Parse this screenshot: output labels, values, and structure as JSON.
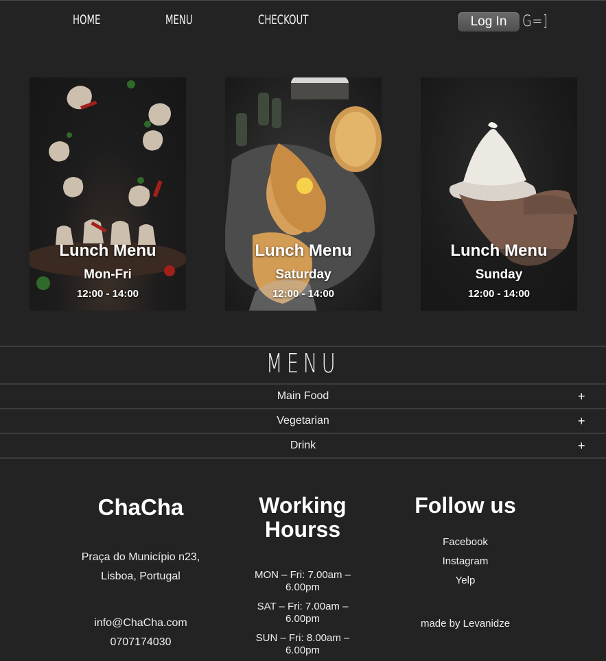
{
  "nav": {
    "home": "HOME",
    "menu": "MENU",
    "checkout": "CHECKOUT",
    "login": "Log In",
    "cart": "G=]"
  },
  "cards": [
    {
      "title": "Lunch Menu",
      "days": "Mon-Fri",
      "hours": "12:00 - 14:00",
      "image": "dumplings-falling"
    },
    {
      "title": "Lunch Menu",
      "days": "Saturday",
      "hours": "12:00 - 14:00",
      "image": "khachapuri"
    },
    {
      "title": "Lunch Menu",
      "days": "Sunday",
      "hours": "12:00 - 14:00",
      "image": "khinkali-in-hand"
    }
  ],
  "menu": {
    "heading": "MENU",
    "items": [
      {
        "label": "Main Food",
        "icon": "+"
      },
      {
        "label": "Vegetarian",
        "icon": "+"
      },
      {
        "label": "Drink",
        "icon": "+"
      }
    ]
  },
  "footer": {
    "brand": {
      "title": "ChaCha",
      "address1": "Praça do Município n23,",
      "address2": "Lisboa, Portugal",
      "email": "info@ChaCha.com",
      "phone": "0707174030"
    },
    "hours": {
      "title1": "Working",
      "title2": "Hourss",
      "lines": [
        [
          "MON – Fri: 7.00am –",
          "6.00pm"
        ],
        [
          "SAT – Fri: 7.00am –",
          "6.00pm"
        ],
        [
          "SUN – Fri: 8.00am –",
          "6.00pm"
        ]
      ]
    },
    "follow": {
      "title": "Follow us",
      "links": [
        "Facebook",
        "Instagram",
        "Yelp"
      ],
      "credit": "made by Levanidze"
    }
  },
  "colors": {
    "background": "#232323",
    "divider": "#3c3c3c",
    "text": "#ffffff"
  }
}
